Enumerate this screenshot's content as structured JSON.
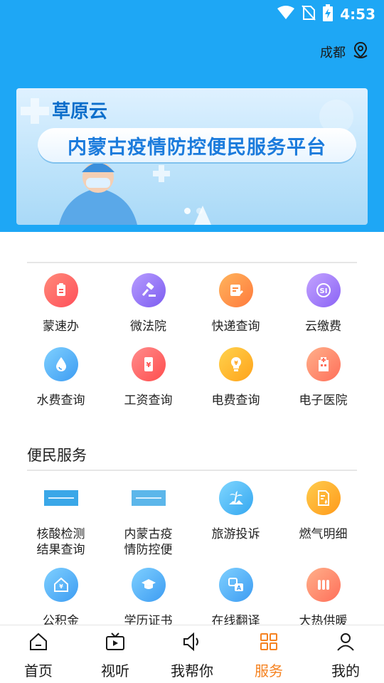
{
  "status_bar": {
    "time": "4:53"
  },
  "location": {
    "city": "成都"
  },
  "banner": {
    "brand": "草原云",
    "title": "内蒙古疫情防控便民服务平台"
  },
  "top_services": [
    {
      "label": "蒙速办",
      "icon": "clipboard-icon",
      "color_from": "#ff8a7a",
      "color_to": "#ff4f5a"
    },
    {
      "label": "微法院",
      "icon": "gavel-icon",
      "color_from": "#b79cff",
      "color_to": "#7c5cf0"
    },
    {
      "label": "快递查询",
      "icon": "package-note-icon",
      "color_from": "#ffb45c",
      "color_to": "#ff7a3d"
    },
    {
      "label": "云缴费",
      "icon": "si-badge-icon",
      "color_from": "#c3a3ff",
      "color_to": "#8a63f5"
    },
    {
      "label": "水费查询",
      "icon": "water-drop-icon",
      "color_from": "#7fd0ff",
      "color_to": "#3d9cf2"
    },
    {
      "label": "工资查询",
      "icon": "phone-yen-icon",
      "color_from": "#ff8c8c",
      "color_to": "#ff4d4d"
    },
    {
      "label": "电费查询",
      "icon": "lightbulb-yen-icon",
      "color_from": "#ffd24d",
      "color_to": "#ffa31a"
    },
    {
      "label": "电子医院",
      "icon": "hospital-icon",
      "color_from": "#ffb08a",
      "color_to": "#ff6f5a"
    }
  ],
  "convenience": {
    "title": "便民服务",
    "items": [
      {
        "label": "核酸检测\n结果查询",
        "icon": "thumbnail-image",
        "type": "thumb"
      },
      {
        "label": "内蒙古疫\n情防控便",
        "icon": "thumbnail-image",
        "type": "thumb"
      },
      {
        "label": "旅游投诉",
        "icon": "palm-tree-icon",
        "color_from": "#7fd6ff",
        "color_to": "#34a7f0"
      },
      {
        "label": "燃气明细",
        "icon": "gas-bill-icon",
        "color_from": "#ffcc4d",
        "color_to": "#ff9a1a"
      },
      {
        "label": "公积金",
        "icon": "house-yen-icon",
        "color_from": "#7fd0ff",
        "color_to": "#3d9cf2"
      },
      {
        "label": "学历证书",
        "icon": "graduation-cap-icon",
        "color_from": "#7fd0ff",
        "color_to": "#3d9cf2"
      },
      {
        "label": "在线翻译",
        "icon": "translate-icon",
        "color_from": "#7fd0ff",
        "color_to": "#3d9cf2"
      },
      {
        "label": "大热供暖",
        "icon": "radiator-icon",
        "color_from": "#ffb08a",
        "color_to": "#ff6f5a"
      }
    ]
  },
  "tabbar": [
    {
      "label": "首页",
      "icon": "home-icon",
      "active": false
    },
    {
      "label": "视听",
      "icon": "tv-icon",
      "active": false
    },
    {
      "label": "我帮你",
      "icon": "speaker-icon",
      "active": false
    },
    {
      "label": "服务",
      "icon": "grid-icon",
      "active": true
    },
    {
      "label": "我的",
      "icon": "user-icon",
      "active": false
    }
  ],
  "colors": {
    "header_blue": "#1ea7f5",
    "active_orange": "#f58220"
  }
}
